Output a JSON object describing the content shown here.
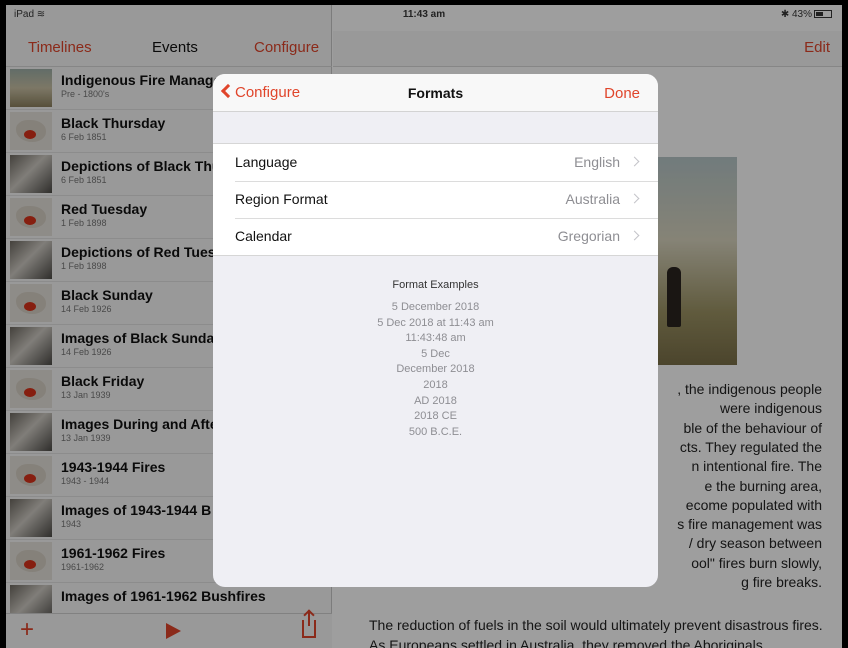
{
  "status": {
    "device": "iPad",
    "time": "11:43 am",
    "battery": "43%",
    "battery_level": 0.43
  },
  "sidebar": {
    "nav": {
      "left": "Timelines",
      "title": "Events",
      "right": "Configure"
    },
    "events": [
      {
        "title": "Indigenous Fire Manage",
        "date": "Pre - 1800's",
        "thumb": "paint"
      },
      {
        "title": "Black Thursday",
        "date": "6 Feb 1851",
        "thumb": "map"
      },
      {
        "title": "Depictions of Black Thu",
        "date": "6 Feb 1851",
        "thumb": "photo"
      },
      {
        "title": "Red Tuesday",
        "date": "1 Feb 1898",
        "thumb": "map"
      },
      {
        "title": "Depictions of Red Tuesc",
        "date": "1 Feb 1898",
        "thumb": "photo"
      },
      {
        "title": "Black Sunday",
        "date": "14 Feb 1926",
        "thumb": "map"
      },
      {
        "title": "Images of Black Sunday",
        "date": "14 Feb 1926",
        "thumb": "photo"
      },
      {
        "title": "Black Friday",
        "date": "13 Jan 1939",
        "thumb": "map"
      },
      {
        "title": "Images During and Afte",
        "date": "13 Jan 1939",
        "thumb": "photo"
      },
      {
        "title": "1943-1944 Fires",
        "date": "1943 - 1944",
        "thumb": "map"
      },
      {
        "title": "Images of 1943-1944 B",
        "date": "1943",
        "thumb": "photo"
      },
      {
        "title": "1961-1962 Fires",
        "date": "1961-1962",
        "thumb": "map"
      },
      {
        "title": "Images of 1961-1962 Bushfires",
        "date": "",
        "thumb": "photo"
      }
    ],
    "toolbar": {
      "add": "+"
    }
  },
  "detail": {
    "edit_label": "Edit",
    "fragments": [
      ", the indigenous people",
      "were indigenous",
      "ble of the behaviour of",
      "cts. They regulated the",
      "n intentional fire. The",
      "e the burning area,",
      "ecome populated with",
      "s fire management was",
      "/ dry season between",
      "ool\" fires burn slowly,",
      "g fire breaks."
    ],
    "paragraph": "The reduction of fuels in the soil would ultimately prevent disastrous fires. As Europeans settled in Australia, they removed the Aboriginals"
  },
  "modal": {
    "back_label": "Configure",
    "title": "Formats",
    "done_label": "Done",
    "settings": [
      {
        "label": "Language",
        "value": "English"
      },
      {
        "label": "Region Format",
        "value": "Australia"
      },
      {
        "label": "Calendar",
        "value": "Gregorian"
      }
    ],
    "examples_title": "Format Examples",
    "examples": [
      "5 December 2018",
      "5 Dec 2018 at 11:43 am",
      "11:43:48 am",
      "5 Dec",
      "December 2018",
      "2018",
      "AD 2018",
      "2018 CE",
      "500 B.C.E."
    ]
  },
  "colors": {
    "accent": "#e0452b"
  }
}
